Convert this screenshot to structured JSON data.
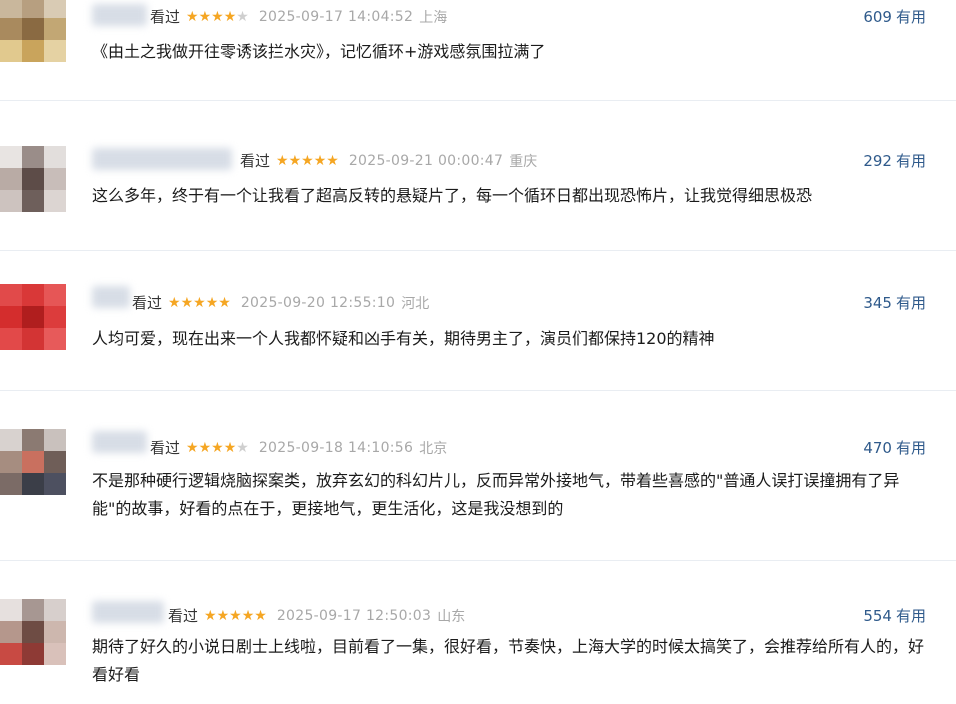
{
  "colors": {
    "star": "#f5a623",
    "star_off": "#cfcfcf",
    "useful": "#2f5a8b",
    "meta": "#a8a8a8"
  },
  "reviews": [
    {
      "verb": "看过",
      "stars": 4,
      "date": "2025-09-17 14:04:52",
      "loc": "上海",
      "useful_count": "609",
      "useful_label": "有用",
      "text": "《由土之我做开往零诱该拦水灾》，记忆循环+游戏感氛围拉满了"
    },
    {
      "verb": "看过",
      "stars": 5,
      "date": "2025-09-21 00:00:47",
      "loc": "重庆",
      "useful_count": "292",
      "useful_label": "有用",
      "text": "这么多年，终于有一个让我看了超高反转的悬疑片了，每一个循环日都出现恐怖片，让我觉得细思极恐"
    },
    {
      "verb": "看过",
      "stars": 5,
      "date": "2025-09-20 12:55:10",
      "loc": "河北",
      "useful_count": "345",
      "useful_label": "有用",
      "text": "人均可爱，现在出来一个人我都怀疑和凶手有关，期待男主了，演员们都保持120的精神"
    },
    {
      "verb": "看过",
      "stars": 4,
      "date": "2025-09-18 14:10:56",
      "loc": "北京",
      "useful_count": "470",
      "useful_label": "有用",
      "text": "不是那种硬行逻辑烧脑探案类，放弃玄幻的科幻片儿，反而异常外接地气，带着些喜感的\"普通人误打误撞拥有了异能\"的故事，好看的点在于，更接地气，更生活化，这是我没想到的"
    },
    {
      "verb": "看过",
      "stars": 5,
      "date": "2025-09-17 12:50:03",
      "loc": "山东",
      "useful_count": "554",
      "useful_label": "有用",
      "text": "期待了好久的小说日剧士上线啦，目前看了一集，很好看，节奏快，上海大学的时候太搞笑了，会推荐给所有人的，好看好看"
    }
  ]
}
